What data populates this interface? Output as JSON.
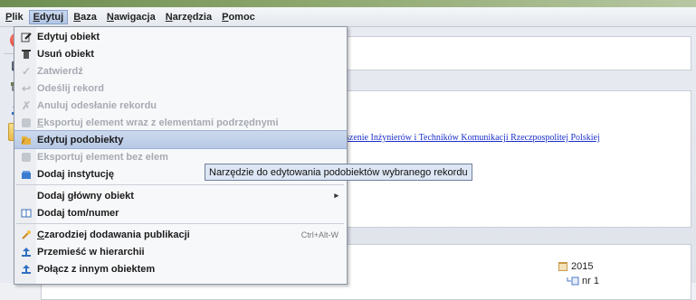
{
  "menubar": {
    "items": [
      {
        "pre": "",
        "acc": "P",
        "post": "lik"
      },
      {
        "pre": "",
        "acc": "E",
        "post": "dytuj"
      },
      {
        "pre": "",
        "acc": "B",
        "post": "aza"
      },
      {
        "pre": "",
        "acc": "N",
        "post": "awigacja"
      },
      {
        "pre": "",
        "acc": "N",
        "post": "arzędzia"
      },
      {
        "pre": "",
        "acc": "P",
        "post": "omoc"
      }
    ]
  },
  "menu": {
    "items": [
      {
        "label": "Edytuj obiekt",
        "icon": "edit-icon"
      },
      {
        "label": "Usuń obiekt",
        "icon": "trash-icon"
      },
      {
        "label": "Zatwierdź",
        "icon": "checkmark-icon"
      },
      {
        "label": "Odeślij rekord",
        "icon": "send-back-icon"
      },
      {
        "label": "Anuluj odesłanie rekordu",
        "icon": "cancel-send-icon"
      },
      {
        "label_acc": "E",
        "label_rest": "ksportuj element wraz z elementami podrzędnymi",
        "icon": "export-icon"
      },
      {
        "label": "Edytuj podobiekty",
        "icon": "edit-subobjects-icon"
      },
      {
        "label": "Eksportuj element bez elem",
        "icon": "export-icon"
      },
      {
        "label": "Dodaj instytucję",
        "icon": "institution-icon"
      },
      {
        "label": "Dodaj główny obiekt",
        "icon": ""
      },
      {
        "label": "Dodaj tom/numer",
        "icon": "book-icon"
      },
      {
        "label_acc": "C",
        "label_rest": "zarodziej dodawania publikacji",
        "shortcut": "Ctrl+Alt-W",
        "icon": "wizard-icon"
      },
      {
        "label": "Przemieść w hierarchii",
        "icon": "move-icon"
      },
      {
        "label": "Połącz z innym obiektem",
        "icon": "link-icon"
      }
    ]
  },
  "tooltip": "Narzędzie do edytowania podobiektów wybranego rekordu",
  "background": {
    "link_text": "szenie Inżynierów i Techników Komunikacji Rzeczpospolitej Polskiej",
    "year": "2015",
    "issue": "nr 1"
  },
  "colors": {
    "highlight": "#b7c9e6",
    "link": "#1a2ec8",
    "disabled": "#a6aab1"
  }
}
